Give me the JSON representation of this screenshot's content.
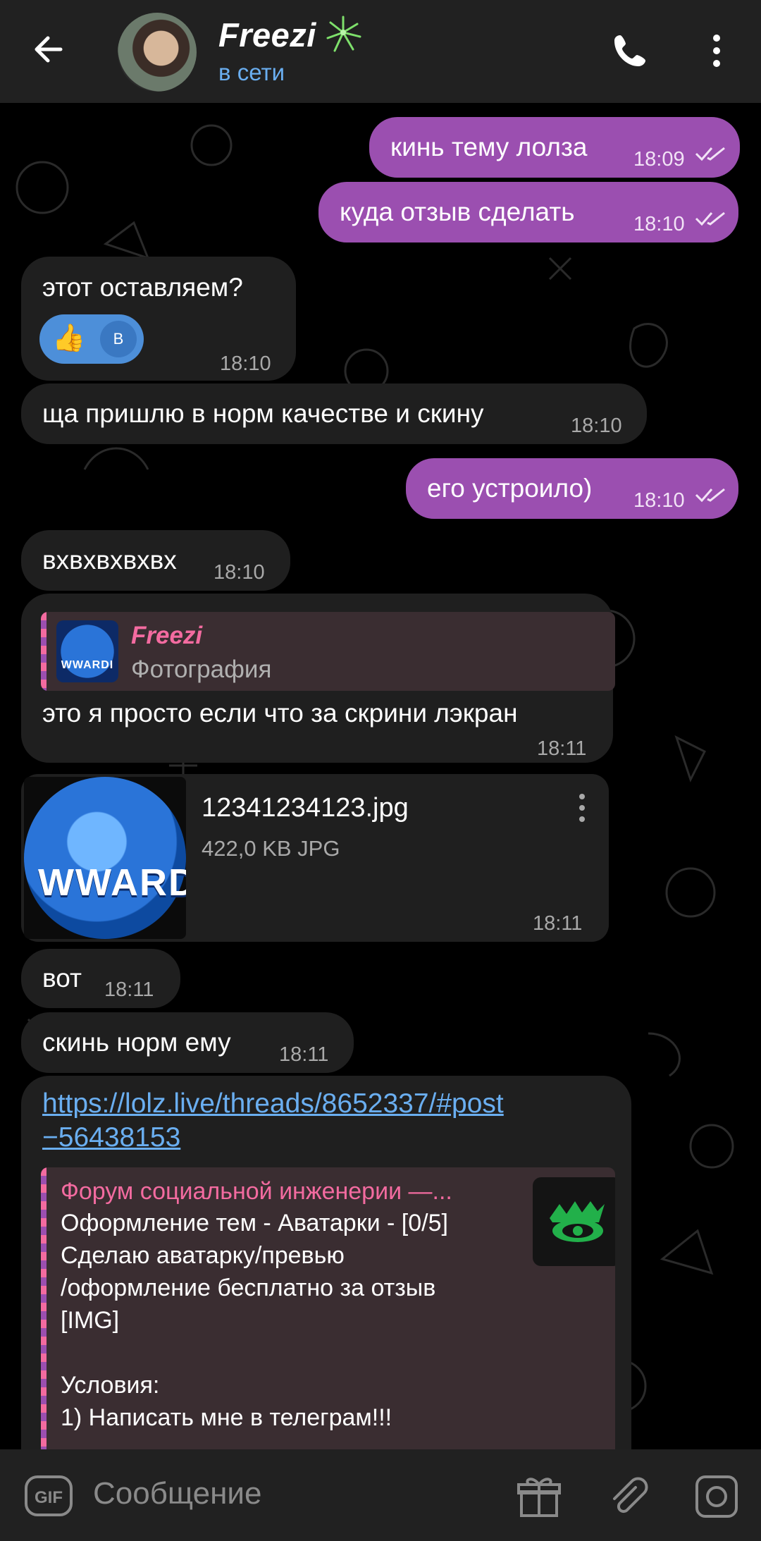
{
  "header": {
    "name": "Freezi",
    "status": "в сети"
  },
  "messages": [
    {
      "dir": "out",
      "text": "кинь тему лолза",
      "time": "18:09"
    },
    {
      "dir": "out",
      "text": "куда отзыв сделать",
      "time": "18:10"
    },
    {
      "dir": "in",
      "text": "этот оставляем?",
      "time": "18:10",
      "reaction": {
        "emoji": "👍",
        "user_initial": "B"
      }
    },
    {
      "dir": "in",
      "text": "ща пришлю в норм качестве и скину",
      "time": "18:10"
    },
    {
      "dir": "out",
      "text": "его устроило)",
      "time": "18:10"
    },
    {
      "dir": "in",
      "text": "вхвхвхвхвх",
      "time": "18:10"
    },
    {
      "dir": "in",
      "reply": {
        "name": "Freezi",
        "type": "Фотография",
        "thumb_text": "WWARDI"
      },
      "text": "это я просто если что за скрини лэкран",
      "time": "18:11"
    },
    {
      "dir": "in",
      "file": {
        "name": "12341234123.jpg",
        "meta": "422,0 KB JPG",
        "thumb_text": "WWARDI"
      },
      "time": "18:11"
    },
    {
      "dir": "in",
      "text": "вот",
      "time": "18:11"
    },
    {
      "dir": "in",
      "text": "скинь норм ему",
      "time": "18:11"
    },
    {
      "dir": "in",
      "link_line1": "https://lolz.live/threads/8652337/#post",
      "link_line2": "−56438153",
      "preview": {
        "site": "Форум социальной инженерии —...",
        "text": "Оформление тем - Аватарки - [0/5]\nСделаю аватарку/превью\n/оформление бесплатно за отзыв\n[IMG]\n\nУсловия:\n1) Написать мне в телеграм!!!"
      }
    }
  ],
  "input": {
    "placeholder": "Сообщение",
    "gif_label": "GIF"
  },
  "colors": {
    "outgoing": "#9b4fb0",
    "incoming": "#1f1f1f",
    "accent": "#6aaef0",
    "header": "#212121"
  }
}
